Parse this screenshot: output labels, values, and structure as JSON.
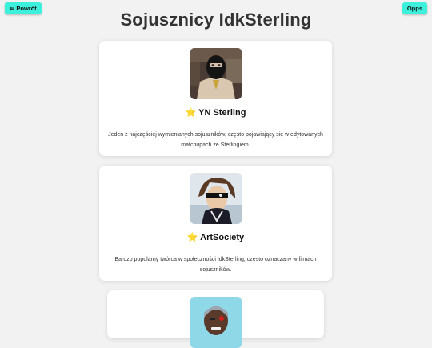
{
  "nav": {
    "back_label": "⇐ Powrót",
    "opps_label": "Opps"
  },
  "page": {
    "title": "Sojusznicy IdkSterling"
  },
  "allies": [
    {
      "name": "⭐ YN Sterling",
      "description": "Jeden z najczęściej wymienianych sojuszników, często pojawiający się w edytowanych matchupach ze Sterlingiem."
    },
    {
      "name": "⭐ ArtSociety",
      "description": "Bardzo popularny twórca w społeczności IdkSterling, często oznaczany w filmach sojuszników."
    }
  ],
  "colors": {
    "accent": "#3df0dc",
    "background": "#f2f2f2",
    "card": "#ffffff",
    "title": "#333333"
  }
}
